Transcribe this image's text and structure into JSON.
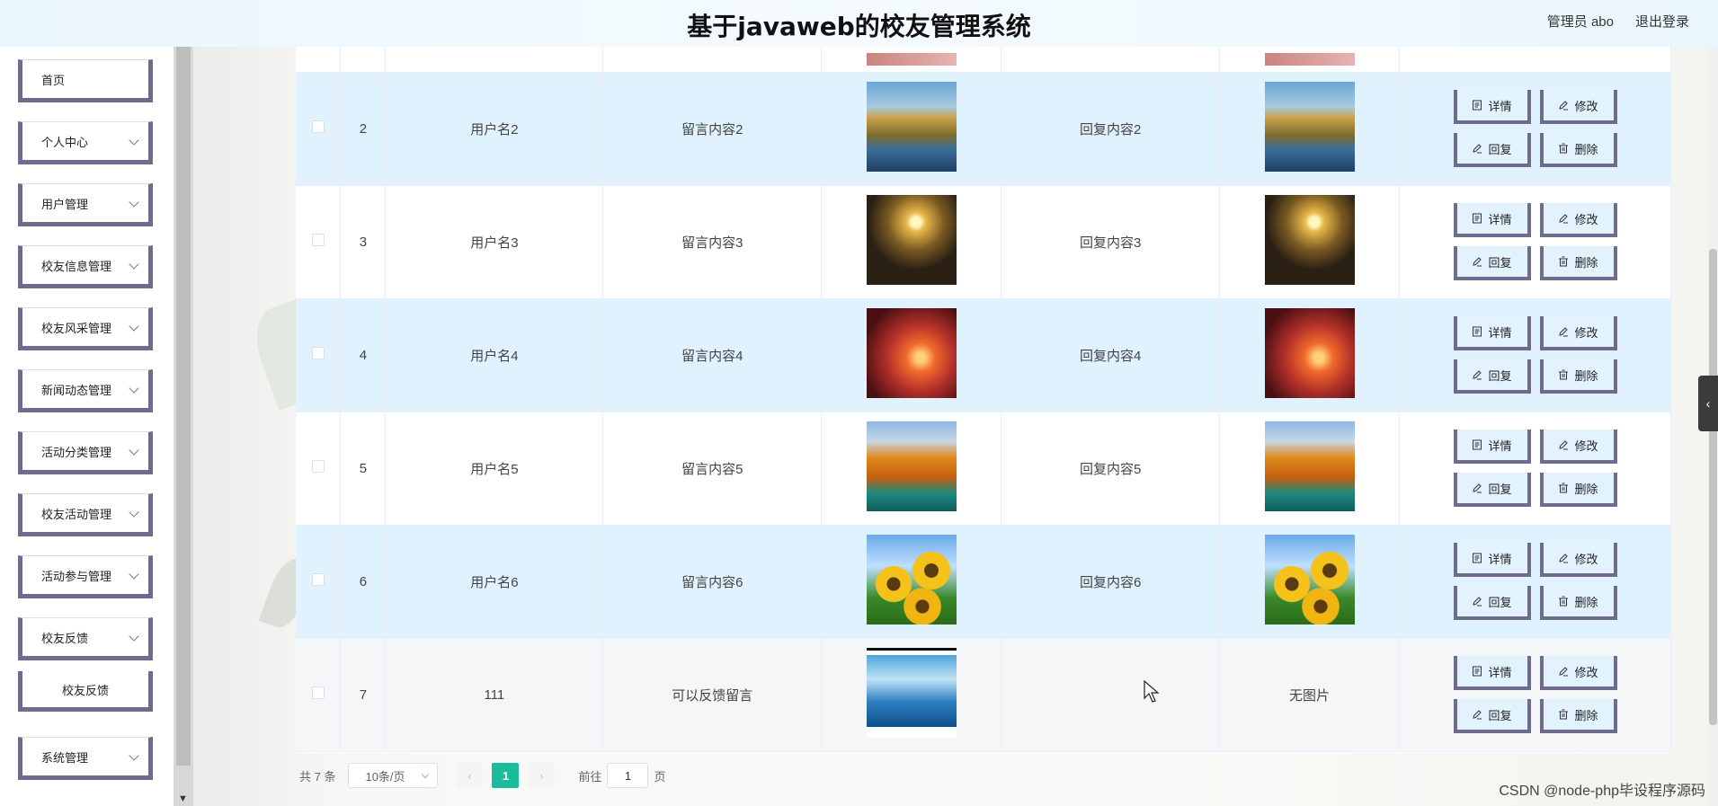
{
  "header": {
    "title": "基于javaweb的校友管理系统",
    "admin_label": "管理员 abo",
    "logout_label": "退出登录"
  },
  "sidebar": {
    "items": [
      {
        "label": "首页",
        "expandable": false
      },
      {
        "label": "个人中心",
        "expandable": true
      },
      {
        "label": "用户管理",
        "expandable": true
      },
      {
        "label": "校友信息管理",
        "expandable": true
      },
      {
        "label": "校友风采管理",
        "expandable": true
      },
      {
        "label": "新闻动态管理",
        "expandable": true
      },
      {
        "label": "活动分类管理",
        "expandable": true
      },
      {
        "label": "校友活动管理",
        "expandable": true
      },
      {
        "label": "活动参与管理",
        "expandable": true
      },
      {
        "label": "校友反馈",
        "expandable": true
      }
    ],
    "subitem": "校友反馈",
    "system": "系统管理"
  },
  "table": {
    "rows": [
      {
        "index": "2",
        "username": "用户名2",
        "message": "留言内容2",
        "image": "mountain-road",
        "reply": "回复内容2",
        "reply_image": "mountain-road",
        "reply_image_text": ""
      },
      {
        "index": "3",
        "username": "用户名3",
        "message": "留言内容3",
        "image": "sunset-beach",
        "reply": "回复内容3",
        "reply_image": "sunset-beach",
        "reply_image_text": ""
      },
      {
        "index": "4",
        "username": "用户名4",
        "message": "留言内容4",
        "image": "red-sky-tree",
        "reply": "回复内容4",
        "reply_image": "red-sky-tree",
        "reply_image_text": ""
      },
      {
        "index": "5",
        "username": "用户名5",
        "message": "留言内容5",
        "image": "autumn-bridge",
        "reply": "回复内容5",
        "reply_image": "autumn-bridge",
        "reply_image_text": ""
      },
      {
        "index": "6",
        "username": "用户名6",
        "message": "留言内容6",
        "image": "sunflowers",
        "reply": "回复内容6",
        "reply_image": "sunflowers",
        "reply_image_text": ""
      },
      {
        "index": "7",
        "username": "111",
        "message": "可以反馈留言",
        "image": "tv-lake",
        "reply": "",
        "reply_image": "",
        "reply_image_text": "无图片"
      }
    ],
    "ops": {
      "detail": "详情",
      "edit": "修改",
      "reply": "回复",
      "delete": "删除"
    }
  },
  "pager": {
    "total": "共 7 条",
    "page_size": "10条/页",
    "current": "1",
    "goto_prefix": "前往",
    "goto_value": "1",
    "goto_suffix": "页"
  },
  "watermark": "CSDN @node-php毕设程序源码",
  "colors": {
    "accent": "#1abc9c",
    "row_alt": "#dff2fd",
    "menu_border": "#6e6b8e"
  }
}
